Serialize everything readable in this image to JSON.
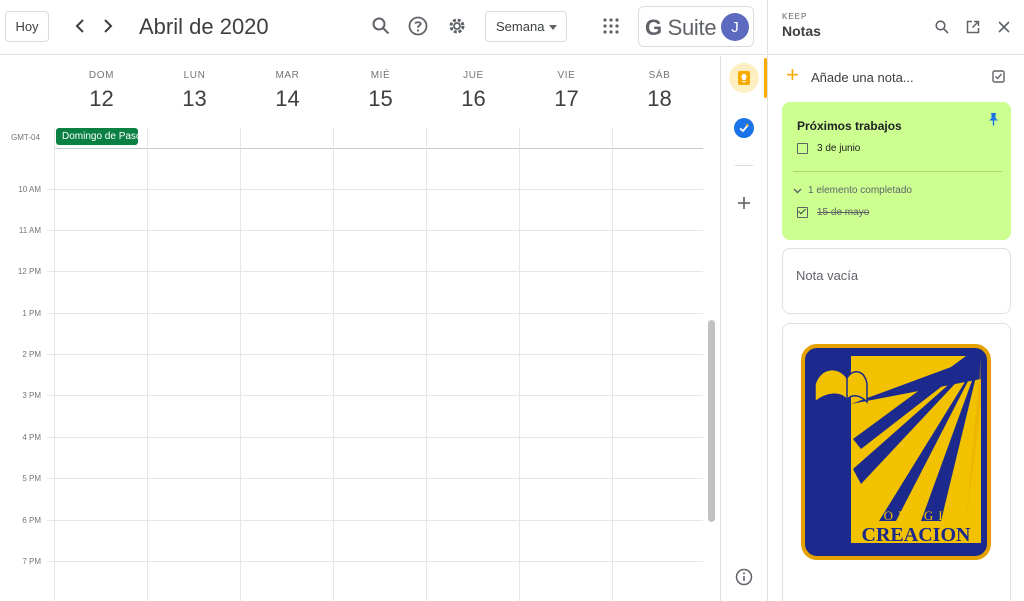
{
  "header": {
    "today_label": "Hoy",
    "month_title": "Abril de 2020",
    "view_selected": "Semana",
    "brand_g": "G",
    "brand_suite": "Suite",
    "avatar_initial": "J"
  },
  "calendar": {
    "timezone": "GMT-04",
    "days": [
      {
        "name": "DOM",
        "num": "12"
      },
      {
        "name": "LUN",
        "num": "13"
      },
      {
        "name": "MAR",
        "num": "14"
      },
      {
        "name": "MIÉ",
        "num": "15"
      },
      {
        "name": "JUE",
        "num": "16"
      },
      {
        "name": "VIE",
        "num": "17"
      },
      {
        "name": "SÁB",
        "num": "18"
      }
    ],
    "allday_event": "Domingo de Pascua",
    "hours": [
      "10 AM",
      "11 AM",
      "12 PM",
      "1 PM",
      "2 PM",
      "3 PM",
      "4 PM",
      "5 PM",
      "6 PM",
      "7 PM"
    ]
  },
  "keep": {
    "app_label": "KEEP",
    "title": "Notas",
    "add_note_label": "Añade una nota...",
    "notes": [
      {
        "title": "Próximos trabajos",
        "items": [
          {
            "text": "3 de junio",
            "checked": false
          }
        ],
        "completed_label": "1 elemento completado",
        "completed_items": [
          {
            "text": "15 de mayo",
            "checked": true
          }
        ],
        "color": "#ccff90"
      },
      {
        "placeholder": "Nota vacía"
      },
      {
        "image": "colegio-creacion-logo",
        "logo_text_top": "COLEGIO",
        "logo_text_bottom": "CREACION"
      }
    ]
  },
  "colors": {
    "event_green": "#0b8043",
    "keep_yellow": "#f9ab00",
    "avatar": "#5c6bc0",
    "tasks_blue": "#1a73e8"
  }
}
